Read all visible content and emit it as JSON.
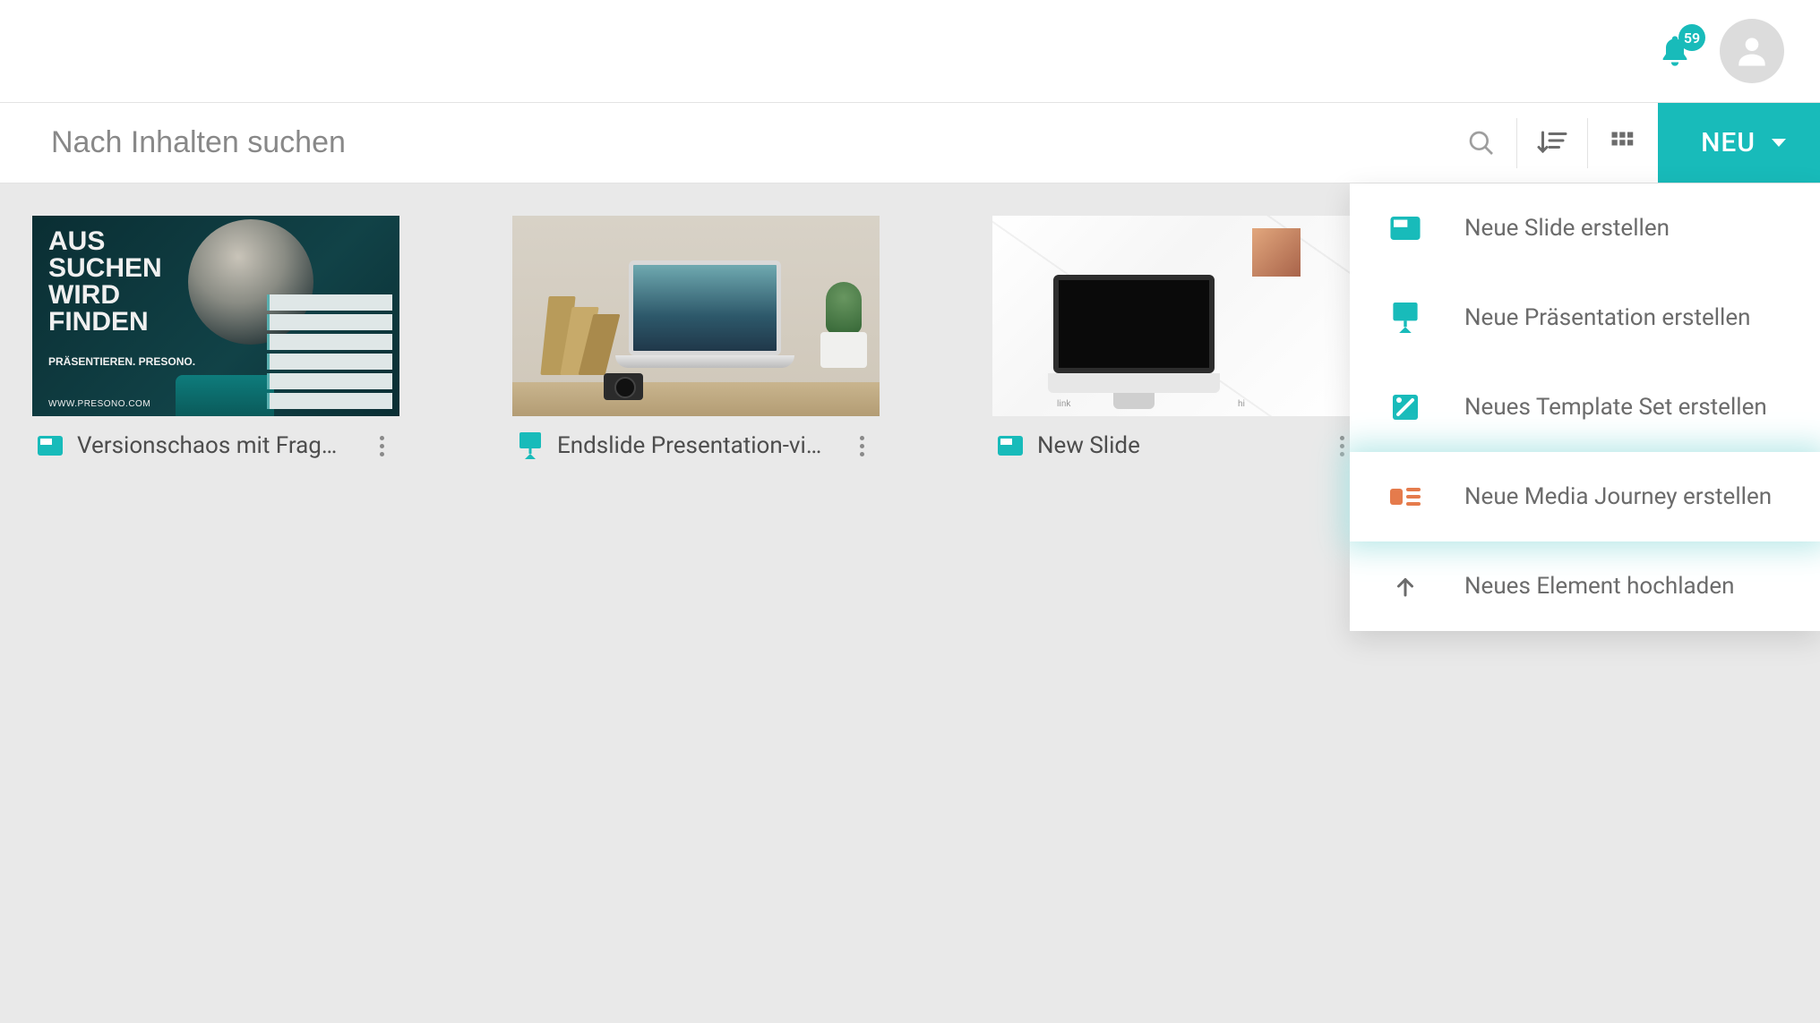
{
  "header": {
    "notification_count": "59"
  },
  "toolbar": {
    "search_placeholder": "Nach Inhalten suchen",
    "new_button_label": "NEU"
  },
  "dropdown": {
    "items": [
      {
        "icon": "slide",
        "label": "Neue Slide erstellen"
      },
      {
        "icon": "presentation",
        "label": "Neue Präsentation erstellen"
      },
      {
        "icon": "template",
        "label": "Neues Template Set erstellen"
      },
      {
        "icon": "journey",
        "label": "Neue Media Journey erstellen"
      },
      {
        "icon": "upload",
        "label": "Neues Element hochladen"
      }
    ],
    "highlight_index": 3
  },
  "content": {
    "cards": [
      {
        "type": "slide",
        "title": "Versionschaos mit Frag…",
        "thumb_text_main": "AUS\nSUCHEN\nWIRD\nFINDEN",
        "thumb_text_sub": "PRÄSENTIEREN.\nPRESONO.",
        "thumb_text_site": "WWW.PRESONO.COM"
      },
      {
        "type": "presentation",
        "title": "Endslide Presentation-vi…"
      },
      {
        "type": "slide",
        "title": "New Slide",
        "thumb_label_left": "link",
        "thumb_label_right": "hi"
      }
    ]
  }
}
